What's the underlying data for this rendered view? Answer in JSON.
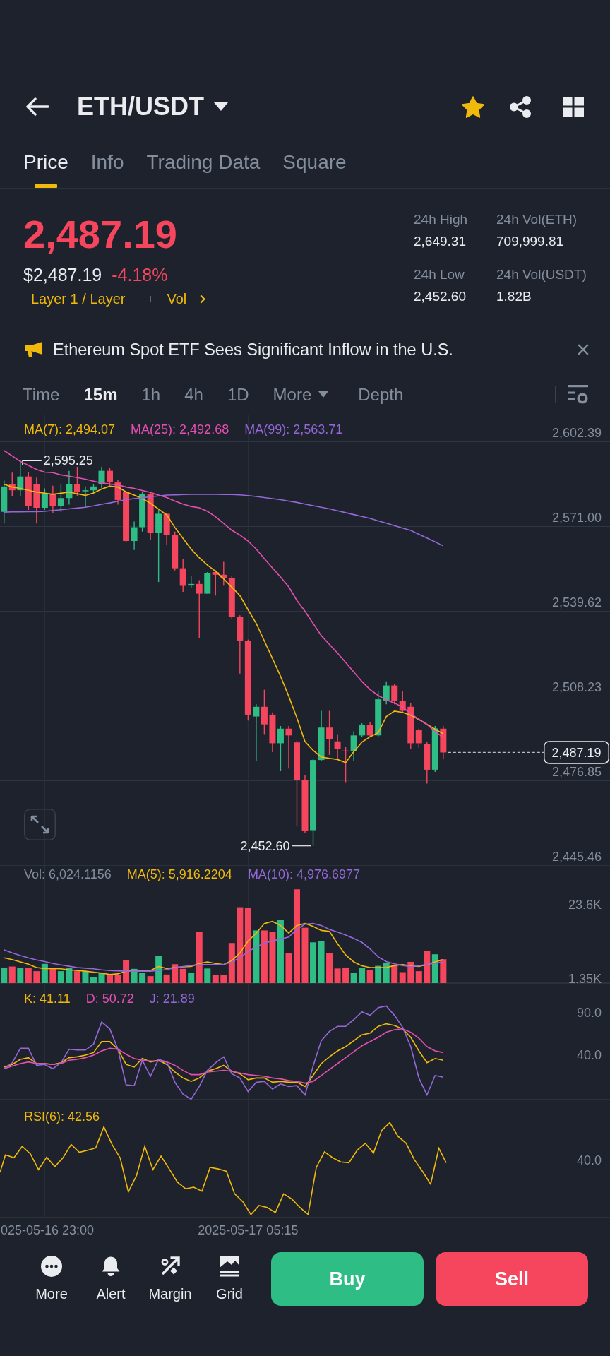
{
  "header": {
    "title": "ETH/USDT",
    "favorite": true
  },
  "tabs": [
    {
      "label": "Price",
      "selected": true
    },
    {
      "label": "Info",
      "selected": false
    },
    {
      "label": "Trading Data",
      "selected": false
    },
    {
      "label": "Square",
      "selected": false
    }
  ],
  "ticker": {
    "price": "2,487.19",
    "fiat_price": "$2,487.19",
    "change": "-4.18%",
    "negative": true,
    "tags": [
      {
        "label": "Layer 1 / Layer",
        "kind": "category"
      },
      {
        "label": "Vol",
        "kind": "link"
      }
    ],
    "stats": [
      {
        "label": "24h High",
        "value": "2,649.31"
      },
      {
        "label": "24h Vol(ETH)",
        "value": "709,999.81"
      },
      {
        "label": "24h Low",
        "value": "2,452.60"
      },
      {
        "label": "24h Vol(USDT)",
        "value": "1.82B"
      }
    ]
  },
  "news": {
    "text": "Ethereum Spot ETF Sees Significant Inflow in the U.S."
  },
  "intervals": [
    {
      "label": "Time",
      "kind": "option",
      "selected": false
    },
    {
      "label": "15m",
      "kind": "option",
      "selected": true
    },
    {
      "label": "1h",
      "kind": "option",
      "selected": false
    },
    {
      "label": "4h",
      "kind": "option",
      "selected": false
    },
    {
      "label": "1D",
      "kind": "option",
      "selected": false
    },
    {
      "label": "More",
      "kind": "dropdown",
      "selected": false
    },
    {
      "label": "Depth",
      "kind": "view",
      "selected": false
    }
  ],
  "price_chart": {
    "legend": [
      {
        "text": "MA(7): 2,494.07",
        "color": "#f0b90b"
      },
      {
        "text": "MA(25): 2,492.68",
        "color": "#e44fb1"
      },
      {
        "text": "MA(99): 2,563.71",
        "color": "#9468d8"
      }
    ],
    "markers": [
      {
        "kind": "high",
        "label": "2,595.25"
      },
      {
        "kind": "low",
        "label": "2,452.60"
      },
      {
        "kind": "last",
        "label": "2,487.19"
      }
    ],
    "chart_data": {
      "type": "candlestick",
      "grid": true,
      "categories": [
        null,
        null,
        null,
        null,
        null,
        null,
        null,
        null,
        null,
        null,
        null,
        null,
        null,
        null,
        null,
        null,
        null,
        null,
        null,
        null,
        null,
        null,
        null,
        null,
        null,
        null,
        null,
        null,
        null,
        null,
        null,
        null,
        null,
        null,
        null,
        null,
        null,
        null,
        null,
        null,
        null,
        null,
        null,
        null,
        null,
        null,
        null,
        null,
        null,
        null,
        null,
        null,
        null,
        null,
        null,
        null,
        null,
        null,
        null,
        null,
        null,
        null,
        null,
        null,
        null,
        null,
        null,
        null,
        null,
        null,
        null,
        null,
        null,
        null,
        null
      ],
      "ylim": [
        2445.46,
        2602.39
      ],
      "yticks": [
        {
          "value": 2602.39,
          "label": "2,602.39"
        },
        {
          "value": 2571.0,
          "label": "2,571.00"
        },
        {
          "value": 2539.62,
          "label": "2,539.62"
        },
        {
          "value": 2508.23,
          "label": "2,508.23"
        },
        {
          "value": 2476.85,
          "label": "2,476.85"
        },
        {
          "value": 2445.46,
          "label": "2,445.46"
        }
      ],
      "ohlc": [
        [
          2576.3,
          2587.9,
          2572.0,
          2585.7
        ],
        [
          2586.5,
          2590.8,
          2582.0,
          2584.3
        ],
        [
          2584.3,
          2595.25,
          2582.0,
          2589.4
        ],
        [
          2589.4,
          2591.0,
          2577.0,
          2578.5
        ],
        [
          2586.5,
          2589.0,
          2572.0,
          2577.8
        ],
        [
          2577.8,
          2585.0,
          2577.0,
          2582.8
        ],
        [
          2582.8,
          2586.0,
          2576.0,
          2578.5
        ],
        [
          2578.5,
          2586.5,
          2576.3,
          2581.4
        ],
        [
          2581.4,
          2591.5,
          2579.0,
          2586.5
        ],
        [
          2586.5,
          2593.0,
          2582.0,
          2583.6
        ],
        [
          2583.9,
          2585.7,
          2577.8,
          2584.3
        ],
        [
          2584.3,
          2586.5,
          2583.0,
          2585.7
        ],
        [
          2586.5,
          2593.0,
          2585.0,
          2591.5
        ],
        [
          2591.5,
          2592.5,
          2586.0,
          2587.2
        ],
        [
          2587.2,
          2588.0,
          2579.0,
          2580.7
        ],
        [
          2583.6,
          2584.0,
          2565.0,
          2565.5
        ],
        [
          2565.5,
          2572.7,
          2562.2,
          2570.6
        ],
        [
          2570.6,
          2583.6,
          2569.0,
          2582.8
        ],
        [
          2582.8,
          2583.6,
          2566.0,
          2568.4
        ],
        [
          2568.4,
          2577.0,
          2550.3,
          2575.6
        ],
        [
          2575.6,
          2576.0,
          2564.0,
          2567.7
        ],
        [
          2567.7,
          2569.0,
          2554.6,
          2555.4
        ],
        [
          2555.4,
          2559.0,
          2546.7,
          2548.9
        ],
        [
          2549.0,
          2552.5,
          2548.0,
          2549.6
        ],
        [
          2549.6,
          2551.0,
          2529.4,
          2546.0
        ],
        [
          2546.0,
          2554.0,
          2546.0,
          2553.5
        ],
        [
          2554.0,
          2554.7,
          2545.3,
          2553.0
        ],
        [
          2553.0,
          2557.8,
          2549.0,
          2551.7
        ],
        [
          2551.7,
          2552.5,
          2536.5,
          2537.3
        ],
        [
          2537.3,
          2538.0,
          2516.4,
          2528.6
        ],
        [
          2528.6,
          2529.0,
          2499.0,
          2501.2
        ],
        [
          2500.5,
          2505.0,
          2484.1,
          2504.1
        ],
        [
          2504.1,
          2510.4,
          2494.0,
          2497.6
        ],
        [
          2501.2,
          2502.0,
          2487.3,
          2490.6
        ],
        [
          2490.6,
          2497.0,
          2480.5,
          2496.0
        ],
        [
          2496.0,
          2497.0,
          2481.2,
          2493.5
        ],
        [
          2490.9,
          2491.5,
          2459.8,
          2476.9
        ],
        [
          2476.9,
          2478.8,
          2457.4,
          2458.1
        ],
        [
          2458.4,
          2485.0,
          2452.6,
          2484.4
        ],
        [
          2484.4,
          2502.6,
          2484.0,
          2496.4
        ],
        [
          2496.4,
          2502.6,
          2486.3,
          2492.1
        ],
        [
          2491.3,
          2494.0,
          2484.8,
          2488.5
        ],
        [
          2487.9,
          2489.2,
          2476.2,
          2487.7
        ],
        [
          2487.7,
          2495.0,
          2484.1,
          2493.5
        ],
        [
          2493.5,
          2498.0,
          2493.0,
          2497.5
        ],
        [
          2497.5,
          2498.5,
          2493.0,
          2493.5
        ],
        [
          2493.5,
          2510.1,
          2493.0,
          2506.9
        ],
        [
          2506.2,
          2513.5,
          2505.0,
          2512.0
        ],
        [
          2512.0,
          2512.5,
          2505.0,
          2506.2
        ],
        [
          2506.2,
          2509.8,
          2502.0,
          2502.6
        ],
        [
          2504.1,
          2505.5,
          2488.5,
          2490.6
        ],
        [
          2495.4,
          2496.0,
          2489.0,
          2490.6
        ],
        [
          2490.2,
          2491.0,
          2475.7,
          2480.8
        ],
        [
          2480.8,
          2497.0,
          2480.0,
          2496.1
        ],
        [
          2496.0,
          2497.0,
          2484.8,
          2487.19
        ],
        null,
        null,
        null,
        null,
        null,
        null,
        null,
        null,
        null,
        null,
        null,
        null,
        null,
        null,
        null,
        null,
        null,
        null,
        null,
        null
      ],
      "series": [
        {
          "type": "line",
          "color": "#f0b90b",
          "values": [
            2586.5,
            2585.5,
            2585,
            2584.3,
            2583.6,
            2583.2,
            2582.8,
            2583.2,
            2583.6,
            2583,
            2582.4,
            2583.3,
            2584.7,
            2585.8,
            2585.5,
            2583.7,
            2582.5,
            2581.2,
            2579.5,
            2577.3,
            2575.2,
            2570.5,
            2566.5,
            2562.5,
            2559.3,
            2556.6,
            2554.3,
            2551.5,
            2548.4,
            2545.3,
            2540,
            2535,
            2528.5,
            2522,
            2515.4,
            2508,
            2500,
            2491.2,
            2488,
            2485.5,
            2485,
            2484.6,
            2483.4,
            2487.5,
            2491,
            2493,
            2494.5,
            2500.5,
            2502.5,
            2502,
            2501,
            2499.4,
            2497.6,
            2495.8,
            2494.1,
            null,
            null,
            null,
            null,
            null,
            null,
            null,
            null,
            null,
            null,
            null,
            null,
            null,
            null,
            null,
            null,
            null,
            null,
            null,
            null
          ]
        },
        {
          "type": "line",
          "color": "#e44fb1",
          "values": [
            2599,
            2597,
            2595,
            2593.5,
            2592,
            2591,
            2590.8,
            2590,
            2589.5,
            2589,
            2588.4,
            2587.7,
            2587,
            2586.6,
            2586.3,
            2585.5,
            2585,
            2584.2,
            2583.5,
            2582.5,
            2581.6,
            2580.3,
            2579.2,
            2578.3,
            2577.8,
            2576.5,
            2574.5,
            2572,
            2569.5,
            2567.7,
            2565.5,
            2562.5,
            2559,
            2555.5,
            2552.2,
            2548.5,
            2543.5,
            2539.5,
            2535,
            2530.5,
            2527.2,
            2524,
            2520.5,
            2517,
            2513.5,
            2510.5,
            2508.3,
            2506.7,
            2505.5,
            2504,
            2501.5,
            2499.5,
            2497.5,
            2495,
            2492.7,
            null,
            null,
            null,
            null,
            null,
            null,
            null,
            null,
            null,
            null,
            null,
            null,
            null,
            null,
            null,
            null,
            null,
            null,
            null,
            null
          ]
        },
        {
          "type": "line",
          "color": "#9468d8",
          "values": [
            2576.2,
            2576.3,
            2576.3,
            2576.4,
            2576.4,
            2576.5,
            2576.8,
            2577.1,
            2577.4,
            2577.7,
            2578,
            2578.5,
            2579.1,
            2579.6,
            2580.2,
            2580.8,
            2581.2,
            2581.5,
            2581.9,
            2582.2,
            2582.5,
            2582.6,
            2582.7,
            2582.8,
            2582.8,
            2582.8,
            2582.8,
            2582.7,
            2582.7,
            2582.6,
            2582.3,
            2582,
            2581.6,
            2581.2,
            2580.8,
            2580.3,
            2579.8,
            2579.2,
            2578.6,
            2578,
            2577.4,
            2576.7,
            2576,
            2575.3,
            2574.6,
            2573.9,
            2573,
            2572.1,
            2571.2,
            2570.3,
            2569.4,
            2568,
            2566.6,
            2565.2,
            2563.7,
            null,
            null,
            null,
            null,
            null,
            null,
            null,
            null,
            null,
            null,
            null,
            null,
            null,
            null,
            null,
            null,
            null,
            null,
            null,
            null
          ]
        }
      ]
    }
  },
  "volume_chart": {
    "legend": [
      {
        "text": "Vol: 6,024.1156",
        "color": "#848e9c"
      },
      {
        "text": "MA(5): 5,916.2204",
        "color": "#f0b90b"
      },
      {
        "text": "MA(10): 4,976.6977",
        "color": "#9468d8"
      }
    ],
    "chart_data": {
      "type": "bar",
      "stacked": true,
      "ylim": [
        0,
        35600
      ],
      "yticks": [
        {
          "value": 23600,
          "label": "23.6K"
        },
        {
          "value": 1350,
          "label": "1.35K"
        }
      ],
      "series": [
        {
          "color": "#2ebd85",
          "values": [
            4700,
            null,
            4500,
            null,
            null,
            5800,
            null,
            3600,
            4500,
            null,
            3600,
            1800,
            3100,
            null,
            null,
            null,
            4300,
            3100,
            null,
            8300,
            null,
            null,
            null,
            3200,
            null,
            4400,
            null,
            null,
            null,
            null,
            null,
            15900,
            null,
            null,
            19100,
            null,
            null,
            null,
            12300,
            12600,
            null,
            null,
            null,
            3200,
            4500,
            null,
            5200,
            6200,
            null,
            null,
            null,
            null,
            null,
            8700,
            null,
            null,
            null,
            null,
            null,
            null,
            null,
            null,
            null,
            null,
            null,
            null,
            null,
            null,
            null,
            null,
            null,
            null,
            null,
            null,
            null
          ]
        },
        {
          "color": "#f6465d",
          "values": [
            null,
            5000,
            null,
            4500,
            3600,
            null,
            4500,
            null,
            null,
            3600,
            null,
            null,
            null,
            2400,
            2400,
            7000,
            null,
            null,
            2100,
            null,
            2600,
            5700,
            4300,
            null,
            15400,
            null,
            2400,
            2400,
            12100,
            22900,
            22600,
            null,
            15900,
            15400,
            null,
            9100,
            28300,
            16700,
            null,
            null,
            9000,
            4400,
            4700,
            null,
            null,
            3900,
            null,
            null,
            5300,
            3300,
            6400,
            3600,
            9700,
            null,
            7200,
            null,
            null,
            null,
            null,
            null,
            null,
            null,
            null,
            null,
            null,
            null,
            null,
            null,
            null,
            null,
            null,
            null,
            null,
            null,
            null
          ]
        },
        {
          "type": "line",
          "color": "#f0b90b",
          "values": [
            7600,
            7100,
            6400,
            5700,
            4700,
            4400,
            4400,
            4300,
            4000,
            3800,
            3600,
            3300,
            3000,
            2600,
            2800,
            3600,
            3800,
            3800,
            3800,
            5000,
            4400,
            4700,
            4900,
            5000,
            5900,
            6400,
            5900,
            5600,
            6800,
            9100,
            12700,
            15100,
            18000,
            18600,
            17400,
            15100,
            17400,
            18000,
            17100,
            15900,
            15600,
            11900,
            8500,
            6400,
            5200,
            4700,
            4700,
            4700,
            5300,
            5600,
            5200,
            5000,
            5600,
            6400,
            7100,
            null,
            null,
            null,
            null,
            null,
            null,
            null,
            null,
            null,
            null,
            null,
            null,
            null,
            null,
            null,
            null,
            null,
            null,
            null,
            null
          ]
        },
        {
          "type": "line",
          "color": "#9468d8",
          "values": [
            10000,
            9100,
            8300,
            7600,
            7000,
            6500,
            5900,
            5500,
            5100,
            4700,
            4500,
            4300,
            4000,
            3800,
            3700,
            3600,
            3600,
            3600,
            3600,
            3800,
            4100,
            4600,
            5000,
            5300,
            5600,
            5600,
            5600,
            5600,
            6400,
            7600,
            9500,
            10900,
            12100,
            12700,
            13300,
            13900,
            16200,
            17800,
            18000,
            17400,
            16200,
            15400,
            14500,
            13500,
            12300,
            10300,
            7900,
            6500,
            5800,
            5300,
            5000,
            5200,
            5700,
            6000,
            6400,
            null,
            null,
            null,
            null,
            null,
            null,
            null,
            null,
            null,
            null,
            null,
            null,
            null,
            null,
            null,
            null,
            null,
            null,
            null,
            null
          ]
        }
      ]
    }
  },
  "kdj_chart": {
    "legend": [
      {
        "text": "K: 41.11",
        "color": "#f0b90b"
      },
      {
        "text": "D: 50.72",
        "color": "#e44fb1"
      },
      {
        "text": "J: 21.89",
        "color": "#9468d8"
      }
    ],
    "chart_data": {
      "type": "line",
      "ylim": [
        -12.5,
        125
      ],
      "yticks": [
        {
          "value": 90,
          "label": "90.0"
        },
        {
          "value": 40,
          "label": "40.0"
        }
      ],
      "series": [
        {
          "color": "#f0b90b",
          "values": [
            26,
            29,
            35,
            37,
            30,
            30,
            29,
            31,
            37,
            38,
            40,
            43,
            56,
            56,
            47,
            29,
            26,
            36,
            32,
            34,
            29,
            20,
            13,
            9,
            13,
            21,
            24,
            28,
            21,
            18,
            11,
            13,
            13,
            8,
            9,
            8,
            8,
            3,
            16,
            30,
            38,
            45,
            50,
            57,
            64,
            66,
            74,
            77,
            75,
            71,
            61,
            45,
            31,
            36,
            34,
            null,
            null,
            null,
            null,
            null,
            null,
            null,
            null,
            null,
            null,
            null,
            null,
            null,
            null,
            null,
            null,
            null,
            null,
            null,
            null
          ]
        },
        {
          "color": "#e44fb1",
          "values": [
            24,
            27,
            30,
            32,
            30,
            30,
            29,
            30,
            34,
            35,
            37,
            40,
            45,
            48,
            47,
            41,
            36,
            34,
            33,
            33,
            32,
            28,
            22,
            17,
            17,
            20,
            21,
            22,
            21,
            19,
            17,
            16,
            15,
            13,
            12,
            10,
            9,
            7,
            9,
            16,
            23,
            30,
            37,
            44,
            51,
            56,
            61,
            67,
            70,
            71,
            67,
            60,
            50,
            45,
            43,
            null,
            null,
            null,
            null,
            null,
            null,
            null,
            null,
            null,
            null,
            null,
            null,
            null,
            null,
            null,
            null,
            null,
            null,
            null,
            null
          ]
        },
        {
          "color": "#9468d8",
          "values": [
            24,
            31,
            48,
            48,
            28,
            29,
            24,
            31,
            47,
            46,
            46,
            53,
            79,
            71,
            47,
            5,
            4,
            34,
            15,
            35,
            32,
            8,
            -6,
            -12,
            3,
            22,
            31,
            38,
            18,
            13,
            -3,
            8,
            9,
            0,
            6,
            3,
            4,
            -7,
            27,
            57,
            68,
            74,
            74,
            82,
            91,
            87,
            96,
            98,
            87,
            73,
            50,
            13,
            -7,
            16,
            14,
            null,
            null,
            null,
            null,
            null,
            null,
            null,
            null,
            null,
            null,
            null,
            null,
            null,
            null,
            null,
            null,
            null,
            null,
            null,
            null
          ]
        }
      ]
    }
  },
  "rsi_chart": {
    "legend": [
      {
        "text": "RSI(6): 42.56"
      }
    ],
    "axis_labels": [
      "40.0"
    ]
  },
  "time_axis": [
    "025-05-16 23:00",
    "2025-05-17 05:15"
  ],
  "toolbar": [
    {
      "label": "More",
      "kind": "more"
    },
    {
      "label": "Alert",
      "kind": "alert"
    },
    {
      "label": "Margin",
      "kind": "margin"
    },
    {
      "label": "Grid",
      "kind": "grid"
    }
  ],
  "actions": [
    {
      "label": "Buy",
      "kind": "buy"
    },
    {
      "label": "Sell",
      "kind": "sell"
    }
  ]
}
